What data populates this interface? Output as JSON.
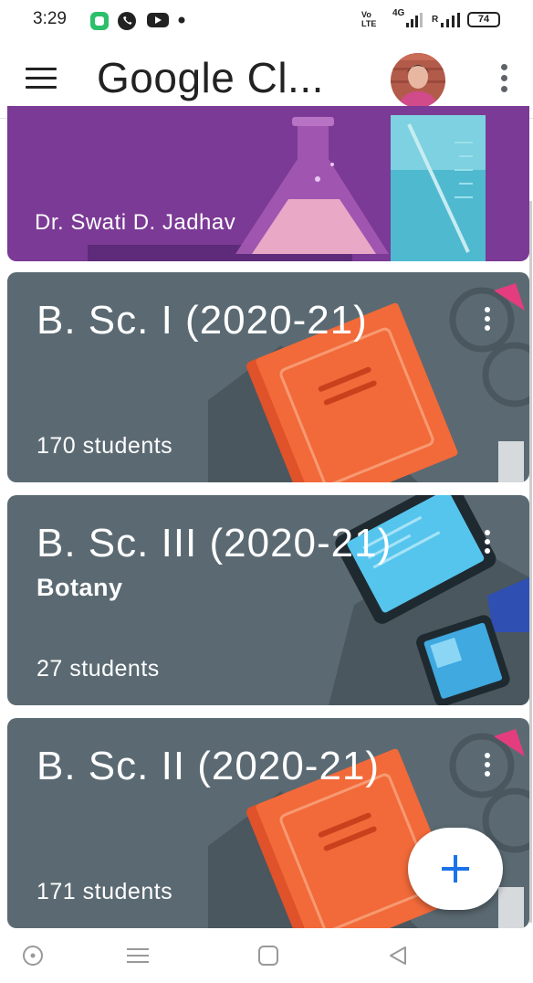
{
  "status_bar": {
    "time": "3:29",
    "network_volte": "Vo LTE",
    "network_4g": "4G",
    "roaming": "R",
    "battery": "74"
  },
  "app_bar": {
    "title": "Google Cl...",
    "menu_icon": "hamburger-menu-icon",
    "more_icon": "more-vert-icon"
  },
  "classes": [
    {
      "owner": "Dr. Swati D. Jadhav",
      "theme": "science-flask",
      "color": "#7b3a95"
    },
    {
      "title": "B. Sc. I (2020-21)",
      "students": "170 students",
      "theme": "book-glasses",
      "color": "#5b6a72"
    },
    {
      "title": "B. Sc. III (2020-21)",
      "section": "Botany",
      "students": "27 students",
      "theme": "tablet-phone",
      "color": "#5b6a72"
    },
    {
      "title": "B. Sc. II (2020-21)",
      "students": "171 students",
      "theme": "book-glasses",
      "color": "#5b6a72"
    }
  ],
  "fab": {
    "icon": "plus-icon",
    "accent": "#1a73e8"
  },
  "nav_bar": {
    "icons": [
      "recent-apps-icon",
      "menu-icon",
      "home-icon",
      "back-icon"
    ]
  }
}
